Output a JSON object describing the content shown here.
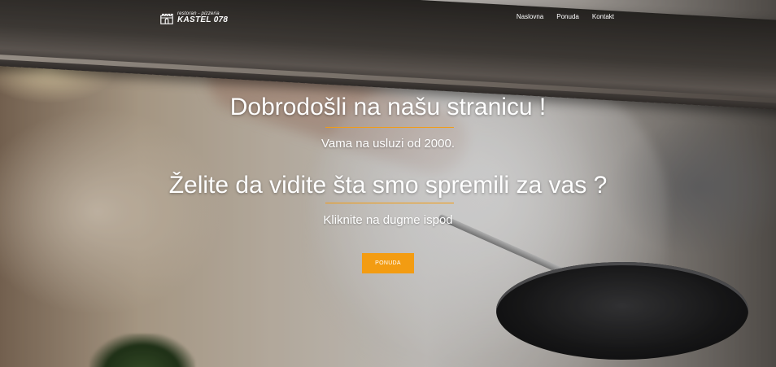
{
  "brand": {
    "tagline": "restoran - pizzeria",
    "name": "KASTEL 078",
    "icon": "castle-icon"
  },
  "nav": {
    "items": [
      {
        "label": "Naslovna"
      },
      {
        "label": "Ponuda"
      },
      {
        "label": "Kontakt"
      }
    ]
  },
  "hero": {
    "title": "Dobrodošli na našu stranicu !",
    "subtitle": "Vama na usluzi od 2000.",
    "title2": "Želite da vidite šta smo spremili za vas ?",
    "subtitle2": "Kliknite na dugme ispod",
    "button_label": "PONUDA"
  },
  "colors": {
    "accent": "#f39c12",
    "text": "#ffffff"
  }
}
